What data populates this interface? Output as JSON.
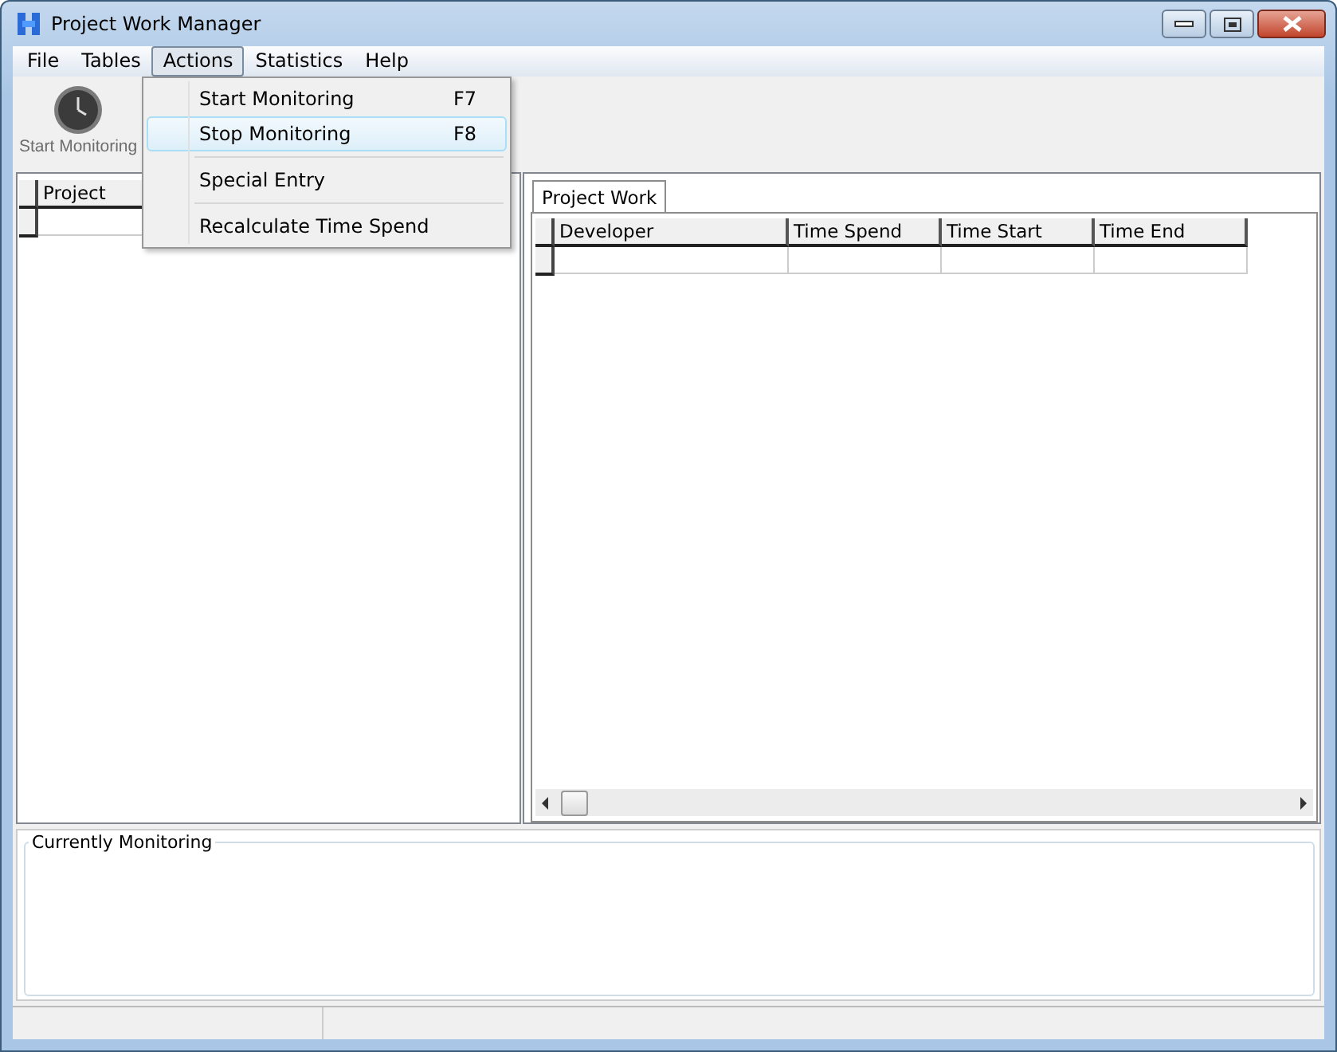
{
  "window": {
    "title": "Project Work Manager"
  },
  "menu_bar": [
    {
      "label": "File",
      "selected": false
    },
    {
      "label": "Tables",
      "selected": false
    },
    {
      "label": "Actions",
      "selected": true
    },
    {
      "label": "Statistics",
      "selected": false
    },
    {
      "label": "Help",
      "selected": false
    }
  ],
  "toolbar": [
    {
      "label": "Start Monitoring"
    }
  ],
  "actions_menu": [
    {
      "kind": "item",
      "label": "Start Monitoring",
      "shortcut": "F7",
      "selected": false
    },
    {
      "kind": "item",
      "label": "Stop Monitoring",
      "shortcut": "F8",
      "selected": true
    },
    {
      "kind": "separator"
    },
    {
      "kind": "item",
      "label": "Special Entry",
      "selected": false
    },
    {
      "kind": "separator"
    },
    {
      "kind": "item",
      "label": "Recalculate Time Spend",
      "selected": false
    }
  ],
  "project_table": {
    "columns": [
      "Project"
    ]
  },
  "tabs": [
    {
      "label": "Project Work",
      "selected": true
    }
  ],
  "work_table": {
    "columns": [
      "Developer",
      "Time Spend",
      "Time Start",
      "Time End"
    ]
  },
  "monitoring_group": {
    "title": "Currently Monitoring"
  }
}
